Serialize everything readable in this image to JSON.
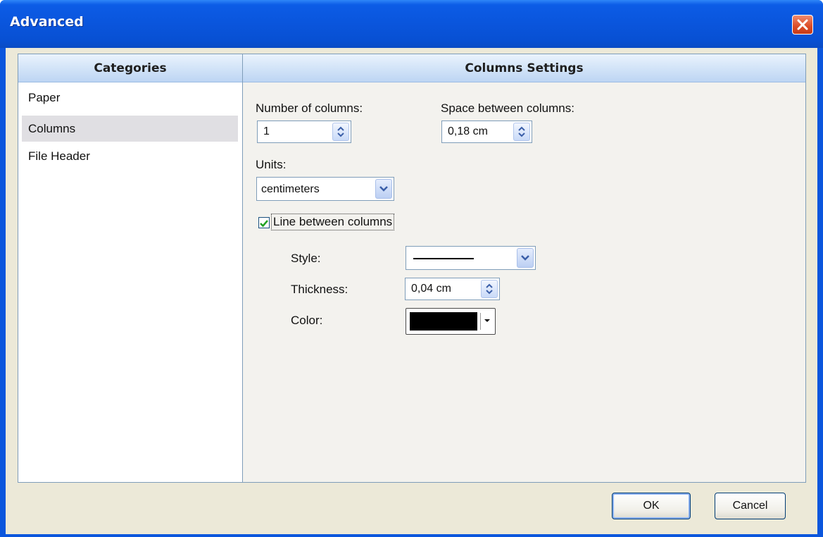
{
  "window": {
    "title": "Advanced"
  },
  "categories": {
    "header": "Categories",
    "items": [
      {
        "label": "Paper",
        "selected": false
      },
      {
        "label": "Columns",
        "selected": true
      },
      {
        "label": "File Header",
        "selected": false
      }
    ]
  },
  "settings": {
    "header": "Columns Settings",
    "number_of_columns": {
      "label": "Number of columns:",
      "value": "1"
    },
    "space_between": {
      "label": "Space between columns:",
      "value": "0,18 cm"
    },
    "units": {
      "label": "Units:",
      "value": "centimeters"
    },
    "line_between": {
      "label": "Line between columns",
      "checked": true
    },
    "style": {
      "label": "Style:",
      "value": "solid-line"
    },
    "thickness": {
      "label": "Thickness:",
      "value": "0,04 cm"
    },
    "color": {
      "label": "Color:",
      "value": "#000000"
    }
  },
  "buttons": {
    "ok": "OK",
    "cancel": "Cancel"
  },
  "icons": [
    "close-icon",
    "spin-arrows-icon",
    "chevron-down-icon",
    "checkmark-icon"
  ],
  "colors": {
    "titlebar": "#0a55dc",
    "close": "#dc4c26",
    "panel_header": "#d3e4f8",
    "dialog": "#ece9d8"
  }
}
